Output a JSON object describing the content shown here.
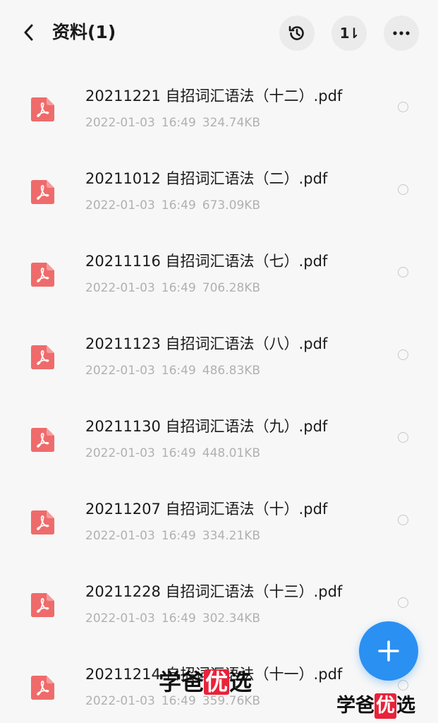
{
  "header": {
    "title": "资料(1)",
    "sort_glyph": "1⇂"
  },
  "files": [
    {
      "name": "20211221 自招词汇语法（十二）.pdf",
      "date": "2022-01-03",
      "time": "16:49",
      "size": "324.74KB"
    },
    {
      "name": "20211012 自招词汇语法（二）.pdf",
      "date": "2022-01-03",
      "time": "16:49",
      "size": "673.09KB"
    },
    {
      "name": "20211116 自招词汇语法（七）.pdf",
      "date": "2022-01-03",
      "time": "16:49",
      "size": "706.28KB"
    },
    {
      "name": "20211123 自招词汇语法（八）.pdf",
      "date": "2022-01-03",
      "time": "16:49",
      "size": "486.83KB"
    },
    {
      "name": "20211130 自招词汇语法（九）.pdf",
      "date": "2022-01-03",
      "time": "16:49",
      "size": "448.01KB"
    },
    {
      "name": "20211207 自招词汇语法（十）.pdf",
      "date": "2022-01-03",
      "time": "16:49",
      "size": "334.21KB"
    },
    {
      "name": "20211228 自招词汇语法（十三）.pdf",
      "date": "2022-01-03",
      "time": "16:49",
      "size": "302.34KB"
    },
    {
      "name": "20211214 自招词汇语法（十一）.pdf",
      "date": "2022-01-03",
      "time": "16:49",
      "size": "359.76KB"
    }
  ],
  "icons": {
    "back": "chevron-left-icon",
    "history": "history-icon",
    "sort": "sort-icon",
    "more": "more-icon",
    "file": "pdf-file-icon",
    "fab": "plus-icon"
  },
  "watermark": {
    "center": {
      "pre": "学爸",
      "highlight": "优",
      "post": "选"
    },
    "corner": {
      "pre": "学爸",
      "highlight": "优",
      "post": "选"
    }
  },
  "colors": {
    "pdf_icon": "#ef6b6b",
    "fab": "#2a90f2",
    "watermark_highlight": "#e8233a",
    "meta_text": "#b1b1b1"
  }
}
